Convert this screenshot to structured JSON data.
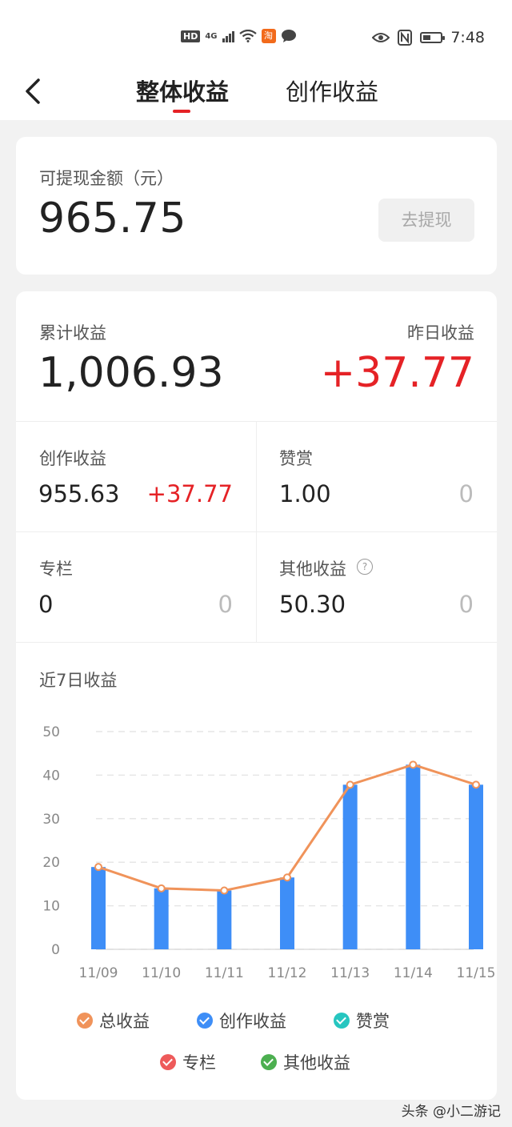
{
  "status_bar": {
    "hd_badge": "HD",
    "network": "4G",
    "app_icon_text": "淘",
    "time": "7:48",
    "icons": [
      "hd-icon",
      "signal-icon",
      "wifi-icon",
      "taobao-app-icon",
      "chat-icon",
      "eye-icon",
      "nfc-icon",
      "battery-icon"
    ],
    "battery_level": 0.45
  },
  "nav": {
    "tabs": [
      {
        "label": "整体收益",
        "active": true
      },
      {
        "label": "创作收益",
        "active": false
      }
    ],
    "accent_color": "#e52226"
  },
  "withdraw": {
    "label": "可提现金额（元）",
    "amount": "965.75",
    "button": "去提现"
  },
  "summary": {
    "total_label": "累计收益",
    "total_amount": "1,006.93",
    "yesterday_label": "昨日收益",
    "yesterday_amount": "+37.77"
  },
  "breakdown": [
    {
      "label": "创作收益",
      "value": "955.63",
      "delta": "+37.77"
    },
    {
      "label": "赞赏",
      "value": "1.00",
      "delta": "0"
    },
    {
      "label": "专栏",
      "value": "0",
      "delta": "0"
    },
    {
      "label": "其他收益",
      "value": "50.30",
      "delta": "0"
    }
  ],
  "chart_title": "近7日收益",
  "chart_data": {
    "type": "bar",
    "categories": [
      "11/09",
      "11/10",
      "11/11",
      "11/12",
      "11/13",
      "11/14",
      "11/15"
    ],
    "y_ticks": [
      "0",
      "10",
      "20",
      "30",
      "40",
      "50"
    ],
    "ylim": [
      0,
      50
    ],
    "grid": true,
    "series": [
      {
        "name": "创作收益",
        "type": "bar",
        "color": "#3e8ef7",
        "values": [
          18.9,
          14.0,
          13.5,
          16.5,
          37.8,
          42.4,
          37.8
        ]
      },
      {
        "name": "总收益",
        "type": "line",
        "color": "#f0935a",
        "values": [
          18.9,
          14.0,
          13.5,
          16.5,
          37.8,
          42.4,
          37.8
        ]
      }
    ],
    "legend": [
      {
        "name": "总收益",
        "color": "#f0935a"
      },
      {
        "name": "创作收益",
        "color": "#3e8ef7"
      },
      {
        "name": "赞赏",
        "color": "#26c6c0"
      },
      {
        "name": "专栏",
        "color": "#ee5a5a"
      },
      {
        "name": "其他收益",
        "color": "#4caf50"
      }
    ],
    "legend_position": "bottom"
  },
  "watermark": "头条 @小二游记"
}
